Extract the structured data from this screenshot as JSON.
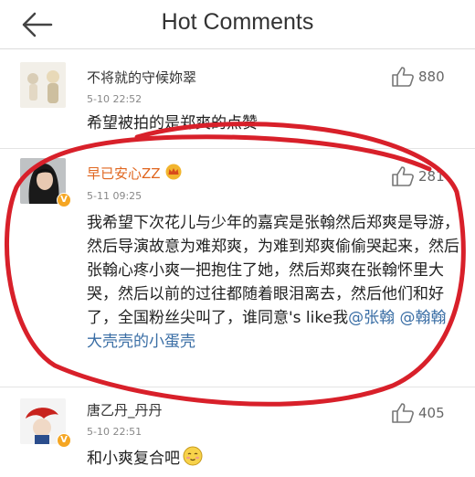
{
  "header": {
    "title": "Hot Comments",
    "back_icon": "back-arrow-icon"
  },
  "comments": [
    {
      "username": "不将就的守候妳翠",
      "time": "5-10 22:52",
      "likes": "880",
      "text": "希望被拍的是郑爽的点赞"
    },
    {
      "username": "早已安心ZZ",
      "time": "5-11 09:25",
      "likes": "281",
      "text": "我希望下次花儿与少年的嘉宾是张翰然后郑爽是导游，然后导演故意为难郑爽，为难到郑爽偷偷哭起来，然后张翰心疼小爽一把抱住了她，然后郑爽在张翰怀里大哭，然后以前的过往都随着眼泪离去，然后他们和好了，全国粉丝尖叫了，谁同意's like我",
      "mention1": "@张翰",
      "mention2": "@翰翰大壳壳的小蛋壳",
      "verified_badge": "V"
    },
    {
      "username": "唐乙丹_丹丹",
      "time": "5-10 22:51",
      "likes": "405",
      "text": "和小爽复合吧",
      "verified_badge": "V"
    }
  ],
  "colors": {
    "accent_orange": "#e0661f",
    "mention_blue": "#3a6ea5",
    "annotation_red": "#d8202a",
    "badge": "#f5a623"
  }
}
